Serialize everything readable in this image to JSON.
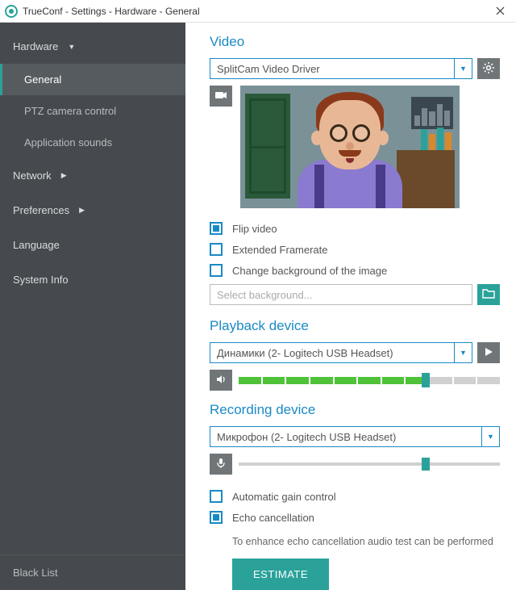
{
  "titlebar": {
    "title": "TrueConf - Settings - Hardware - General"
  },
  "sidebar": {
    "hardware": {
      "label": "Hardware",
      "items": [
        {
          "label": "General",
          "active": true
        },
        {
          "label": "PTZ camera control",
          "active": false
        },
        {
          "label": "Application sounds",
          "active": false
        }
      ]
    },
    "network": {
      "label": "Network"
    },
    "preferences": {
      "label": "Preferences"
    },
    "language": {
      "label": "Language"
    },
    "system_info": {
      "label": "System Info"
    },
    "blacklist": {
      "label": "Black List"
    }
  },
  "video": {
    "title": "Video",
    "device": "SplitCam Video Driver",
    "flip": {
      "label": "Flip video",
      "checked": true
    },
    "extended": {
      "label": "Extended Framerate",
      "checked": false
    },
    "change_bg": {
      "label": "Change background of the image",
      "checked": false
    },
    "bg_placeholder": "Select background..."
  },
  "playback": {
    "title": "Playback device",
    "device": "Динамики (2- Logitech USB Headset)",
    "level_percent": 70
  },
  "recording": {
    "title": "Recording device",
    "device": "Микрофон (2- Logitech USB Headset)",
    "level_percent": 70,
    "agc": {
      "label": "Automatic gain control",
      "checked": false
    },
    "echo": {
      "label": "Echo cancellation",
      "checked": true
    },
    "hint": "To enhance echo cancellation audio test can be performed",
    "estimate_label": "ESTIMATE"
  }
}
